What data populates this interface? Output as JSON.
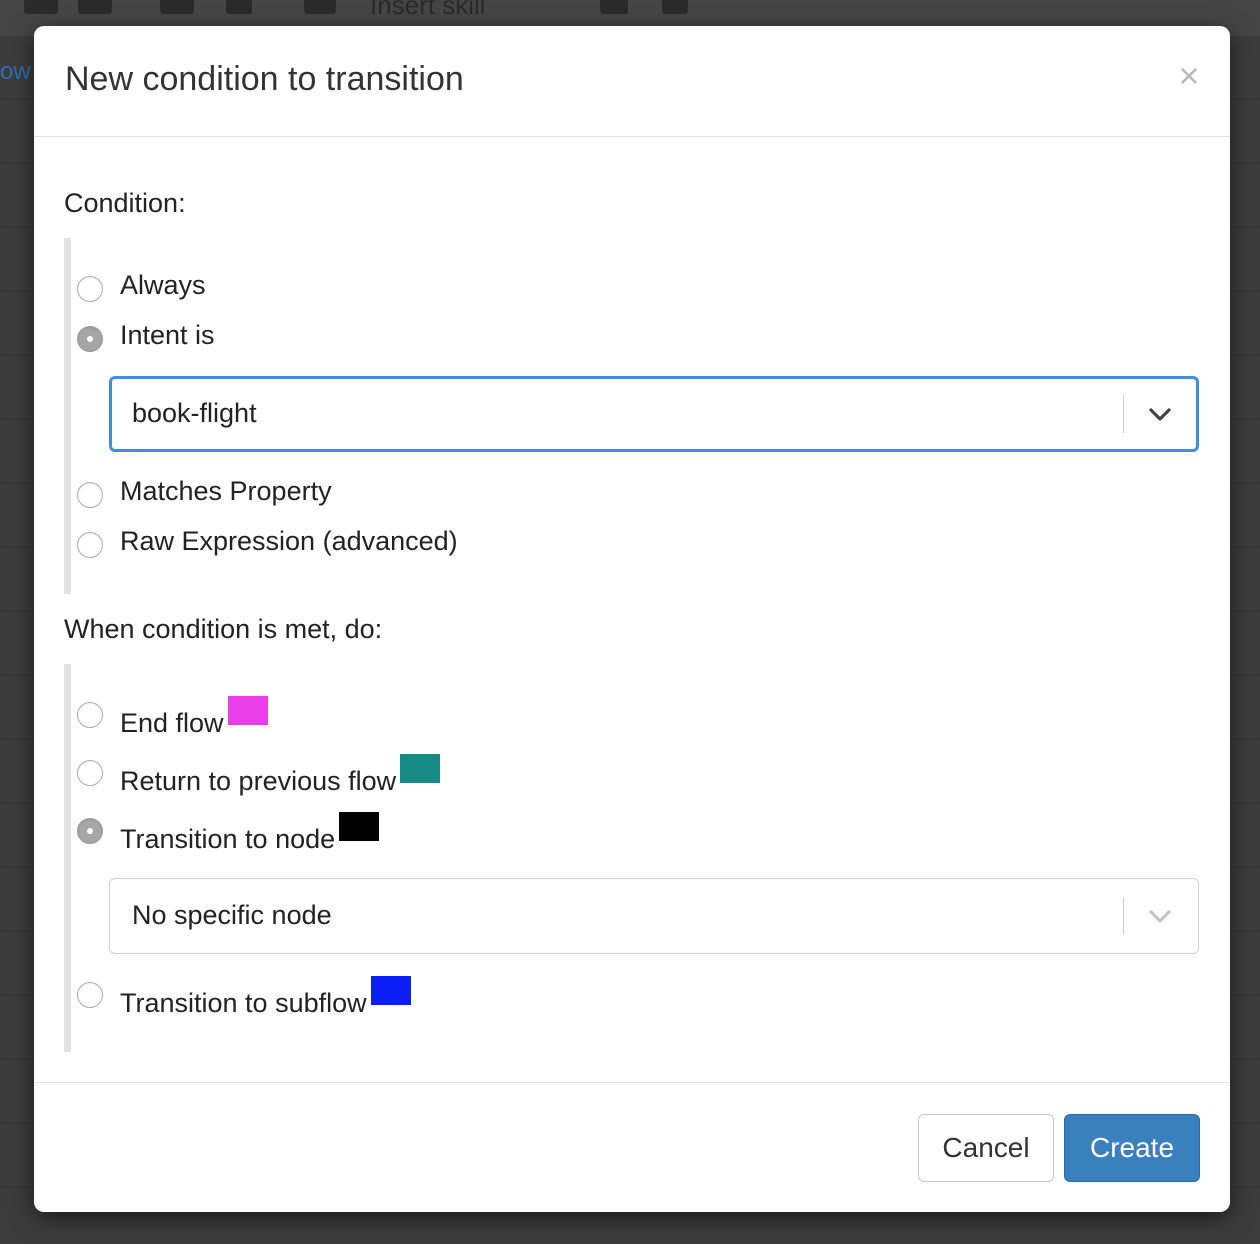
{
  "background": {
    "toolbar_text": "Insert skill",
    "left_text": "ow"
  },
  "modal": {
    "title": "New condition to transition",
    "close_label": "×"
  },
  "condition": {
    "label": "Condition:",
    "options": [
      {
        "label": "Always",
        "checked": false
      },
      {
        "label": "Intent is",
        "checked": true
      },
      {
        "label": "Matches Property",
        "checked": false
      },
      {
        "label": "Raw Expression (advanced)",
        "checked": false
      }
    ],
    "intent_select_value": "book-flight"
  },
  "action": {
    "label": "When condition is met, do:",
    "options": [
      {
        "label": "End flow",
        "checked": false,
        "color": "#e83ee8"
      },
      {
        "label": "Return to previous flow",
        "checked": false,
        "color": "#168a84"
      },
      {
        "label": "Transition to node",
        "checked": true,
        "color": "#000000"
      },
      {
        "label": "Transition to subflow",
        "checked": false,
        "color": "#0b1ff5"
      }
    ],
    "node_select_value": "No specific node"
  },
  "footer": {
    "cancel_label": "Cancel",
    "create_label": "Create"
  }
}
